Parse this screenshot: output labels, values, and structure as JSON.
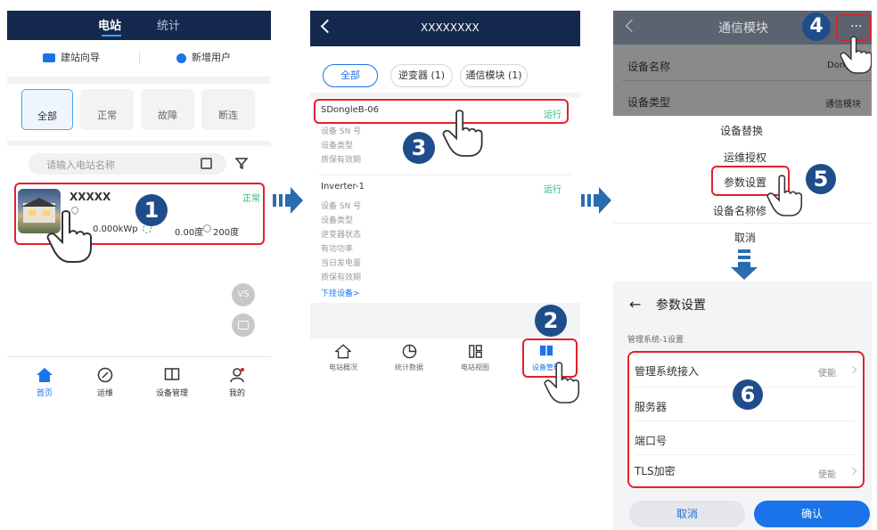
{
  "panel1": {
    "tabs": [
      "电站",
      "统计"
    ],
    "actions": [
      "建站向导",
      "新增用户"
    ],
    "filters": [
      "全部",
      "正常",
      "故障",
      "断连"
    ],
    "search_placeholder": "请输入电站名称",
    "station": {
      "name": "XXXXX",
      "status": "正常",
      "capacity": "0.000kWp",
      "energy": "0.00度",
      "total": "200度"
    },
    "side_buttons": [
      "VS",
      ""
    ],
    "nav": [
      "首页",
      "运维",
      "设备管理",
      "我的"
    ],
    "step": "1"
  },
  "panel2": {
    "title": "XXXXXXXX",
    "filters": [
      "全部",
      "逆变器 (1)",
      "通信模块 (1)"
    ],
    "device1": {
      "name": "SDongleB-06",
      "status": "运行",
      "fields": [
        "设备 SN 号",
        "设备类型",
        "质保有效期"
      ]
    },
    "device2": {
      "name": "Inverter-1",
      "status": "运行",
      "fields": [
        "设备 SN 号",
        "设备类型",
        "逆变器状态",
        "有功功率",
        "当日发电量",
        "质保有效期"
      ],
      "link": "下挂设备>"
    },
    "nav": [
      "电站概况",
      "统计数据",
      "电站视图",
      "设备管理"
    ],
    "steps": [
      "2",
      "3"
    ]
  },
  "panel3": {
    "title": "通信模块",
    "rows": [
      {
        "label": "设备名称",
        "value": "Dongl"
      },
      {
        "label": "设备类型",
        "value": "通信模块"
      }
    ],
    "menu": [
      "设备替换",
      "运维授权",
      "参数设置",
      "设备名称修",
      "取消"
    ],
    "steps": [
      "4",
      "5"
    ]
  },
  "panel4": {
    "title": "参数设置",
    "section": "管理系统-1设置",
    "rows": [
      {
        "label": "管理系统接入",
        "value": "使能"
      },
      {
        "label": "服务器",
        "value": ""
      },
      {
        "label": "端口号",
        "value": ""
      },
      {
        "label": "TLS加密",
        "value": "使能"
      }
    ],
    "cancel": "取消",
    "confirm": "确认",
    "step": "6"
  },
  "colors": {
    "dark": "#14294d",
    "accent": "#1a73e8",
    "red": "#e3202a",
    "green": "#2bb673",
    "step": "#1f4d8c"
  }
}
